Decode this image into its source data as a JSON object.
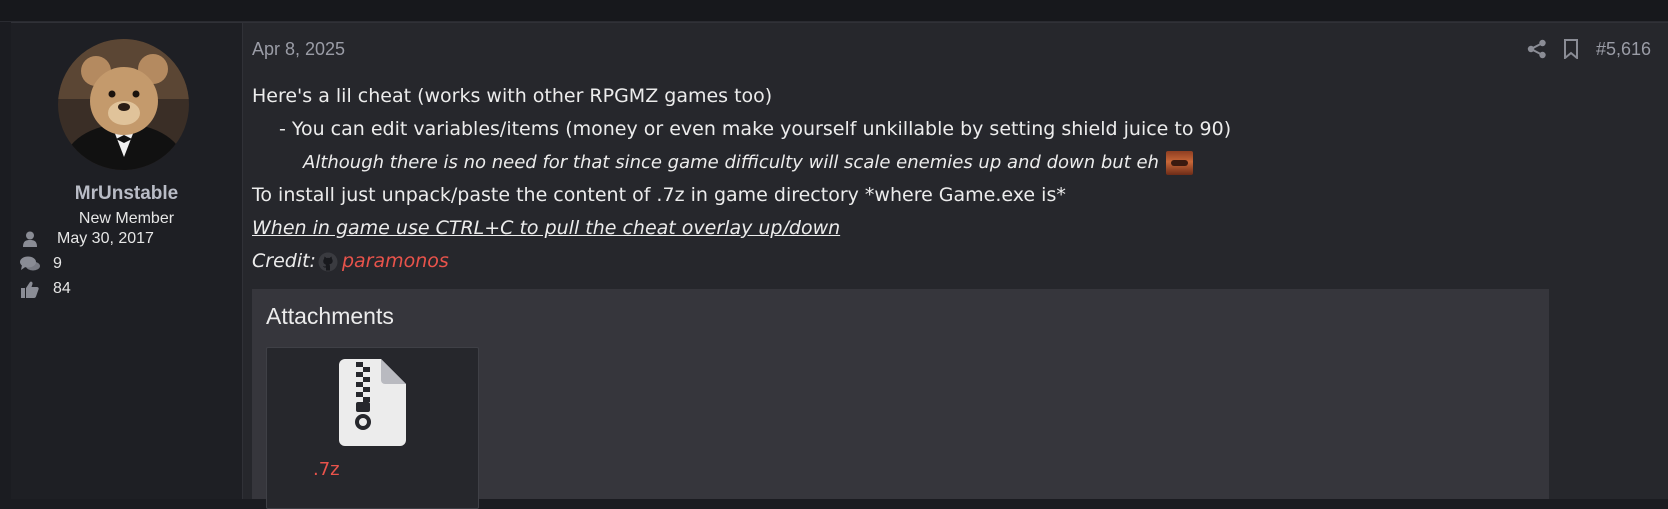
{
  "post": {
    "date": "Apr 8, 2025",
    "number": "#5,616",
    "icons": {
      "share": "share-icon",
      "bookmark": "bookmark-icon"
    }
  },
  "user": {
    "name": "MrUnstable",
    "title": "New Member",
    "joined": "May 30, 2017",
    "messages": "9",
    "reactions": "84"
  },
  "content": {
    "line1": "Here's a lil cheat (works with other RPGMZ games too)",
    "line2": "- You can edit variables/items (money or even make yourself unkillable by setting shield juice to 90)",
    "line3": "Although there is no need for that since game difficulty will scale enemies up and down but eh",
    "line4": "To install just unpack/paste the content of .7z in game directory *where Game.exe is*",
    "line5": "When in game use CTRL+C to pull the cheat overlay up/down",
    "credit_label": "Credit:",
    "credit_link": "paramonos"
  },
  "attachments": {
    "title": "Attachments",
    "file_label": ".7z"
  },
  "colors": {
    "link": "#e8534b",
    "muted": "#9a9ca6",
    "background": "#26272c"
  }
}
